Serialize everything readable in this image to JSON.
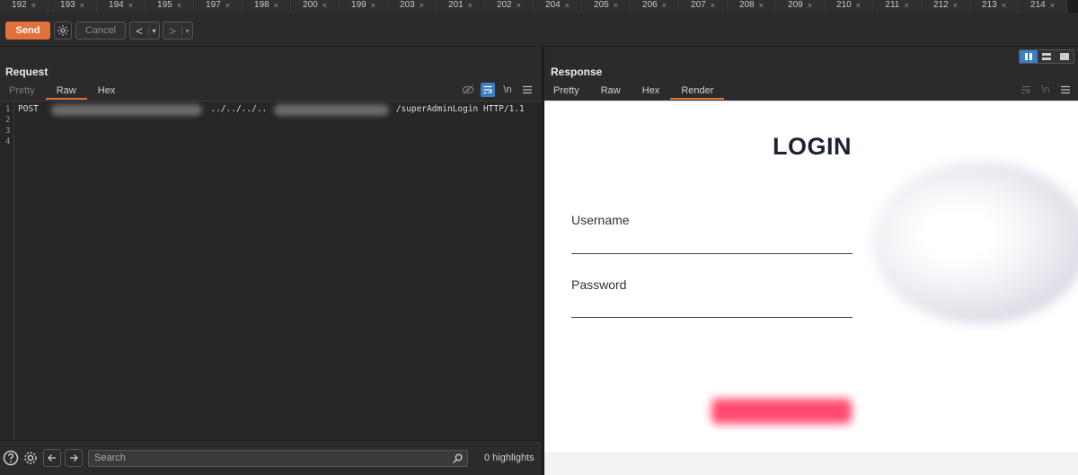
{
  "tabs": [
    "192",
    "193",
    "194",
    "195",
    "197",
    "198",
    "200",
    "199",
    "203",
    "201",
    "202",
    "204",
    "205",
    "206",
    "207",
    "208",
    "209",
    "210",
    "211",
    "212",
    "213",
    "214"
  ],
  "tab_close_glyph": "×",
  "toolbar": {
    "send_label": "Send",
    "cancel_label": "Cancel",
    "back_glyph": "<",
    "forward_glyph": ">",
    "dropdown_glyph": "▾"
  },
  "request": {
    "title": "Request",
    "tabs": [
      "Pretty",
      "Raw",
      "Hex"
    ],
    "active_tab": "Raw",
    "line_numbers": [
      "1",
      "2",
      "3",
      "4"
    ],
    "line1": {
      "method": "POST",
      "path_mid": "../../../..",
      "path_end": "/superAdminLogin HTTP/1.1"
    },
    "wrap_glyph": "\\n"
  },
  "response": {
    "title": "Response",
    "tabs": [
      "Pretty",
      "Raw",
      "Hex",
      "Render"
    ],
    "active_tab": "Render",
    "render": {
      "heading": "LOGIN",
      "username_label": "Username",
      "password_label": "Password"
    }
  },
  "bottom": {
    "search_placeholder": "Search",
    "highlights": "0 highlights"
  },
  "colors": {
    "accent": "#e2713b",
    "toggle_on": "#3d7fc4",
    "login_button": "#ff4a6e"
  }
}
